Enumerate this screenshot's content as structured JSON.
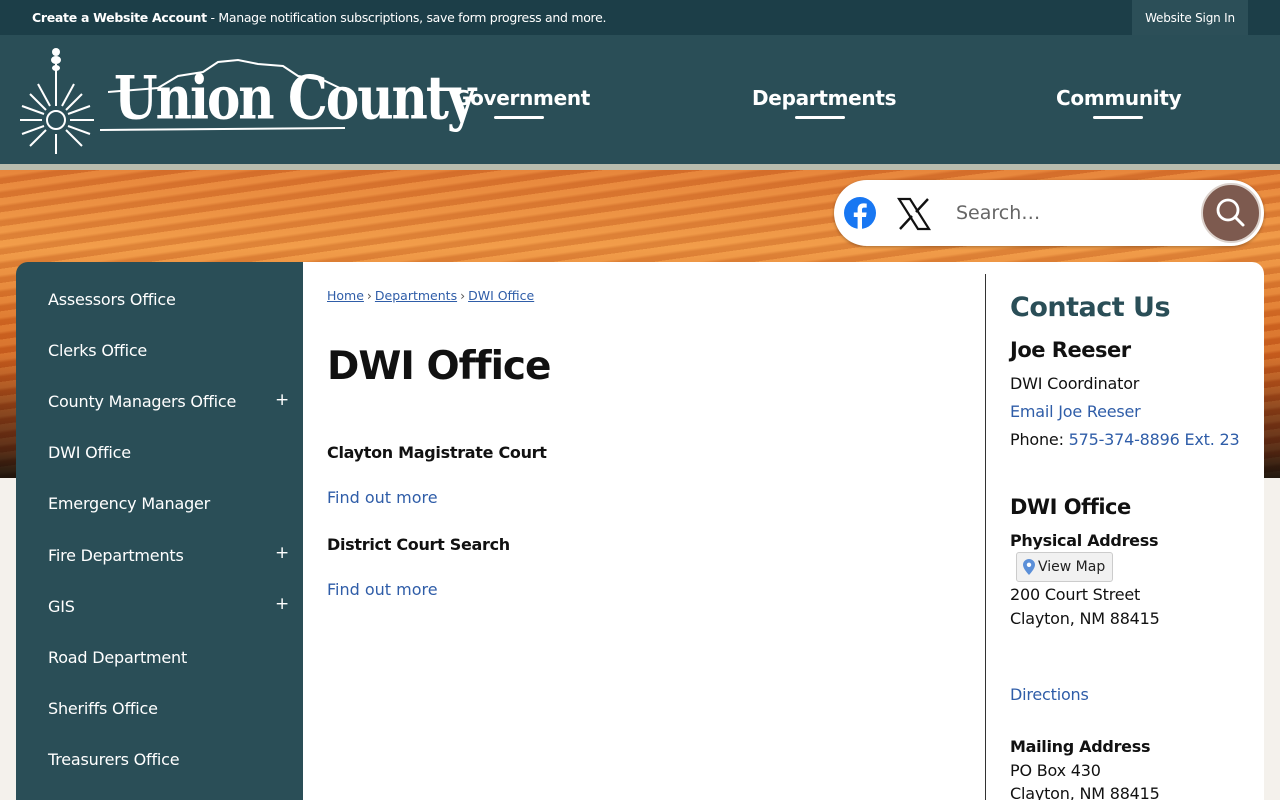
{
  "topbar": {
    "account_link": "Create a Website Account",
    "account_desc": " - Manage notification subscriptions, save form progress and more.",
    "sign_in": "Website Sign In"
  },
  "header": {
    "logo_text": "Union County",
    "nav": [
      "Government",
      "Departments",
      "Community"
    ]
  },
  "search": {
    "placeholder": "Search…",
    "social": [
      "facebook-icon",
      "x-icon"
    ]
  },
  "sidebar": {
    "items": [
      {
        "label": "Assessors Office",
        "expandable": false
      },
      {
        "label": "Clerks Office",
        "expandable": false
      },
      {
        "label": "County Managers Office",
        "expandable": true
      },
      {
        "label": "DWI Office",
        "expandable": false
      },
      {
        "label": "Emergency Manager",
        "expandable": false
      },
      {
        "label": "Fire Departments",
        "expandable": true
      },
      {
        "label": "GIS",
        "expandable": true
      },
      {
        "label": "Road Department",
        "expandable": false
      },
      {
        "label": "Sheriffs Office",
        "expandable": false
      },
      {
        "label": "Treasurers Office",
        "expandable": false
      }
    ],
    "plus_symbol": "+"
  },
  "breadcrumb": {
    "items": [
      "Home",
      "Departments",
      "DWI Office"
    ],
    "separator": "›"
  },
  "main": {
    "title": "DWI Office",
    "links": [
      {
        "title": "Clayton Magistrate Court",
        "action": "Find out more"
      },
      {
        "title": "District Court Search",
        "action": "Find out more"
      }
    ]
  },
  "contact": {
    "heading": "Contact Us",
    "name": "Joe Reeser",
    "role": "DWI Coordinator",
    "email_link": "Email Joe Reeser",
    "phone_label": "Phone: ",
    "phone": "575-374-8896 Ext. 23",
    "office_title": "DWI Office",
    "physical_label": "Physical Address",
    "view_map": "View Map",
    "street": "200 Court Street",
    "city": "Clayton, NM 88415",
    "directions": "Directions",
    "mailing_label": "Mailing Address",
    "po_box": "PO Box 430",
    "mail_city": "Clayton, NM 88415"
  },
  "colors": {
    "header": "#2a4e57",
    "topbar": "#1c3e48",
    "link": "#2f5da8",
    "search_button": "#7d5a4f",
    "facebook": "#1877f2"
  }
}
